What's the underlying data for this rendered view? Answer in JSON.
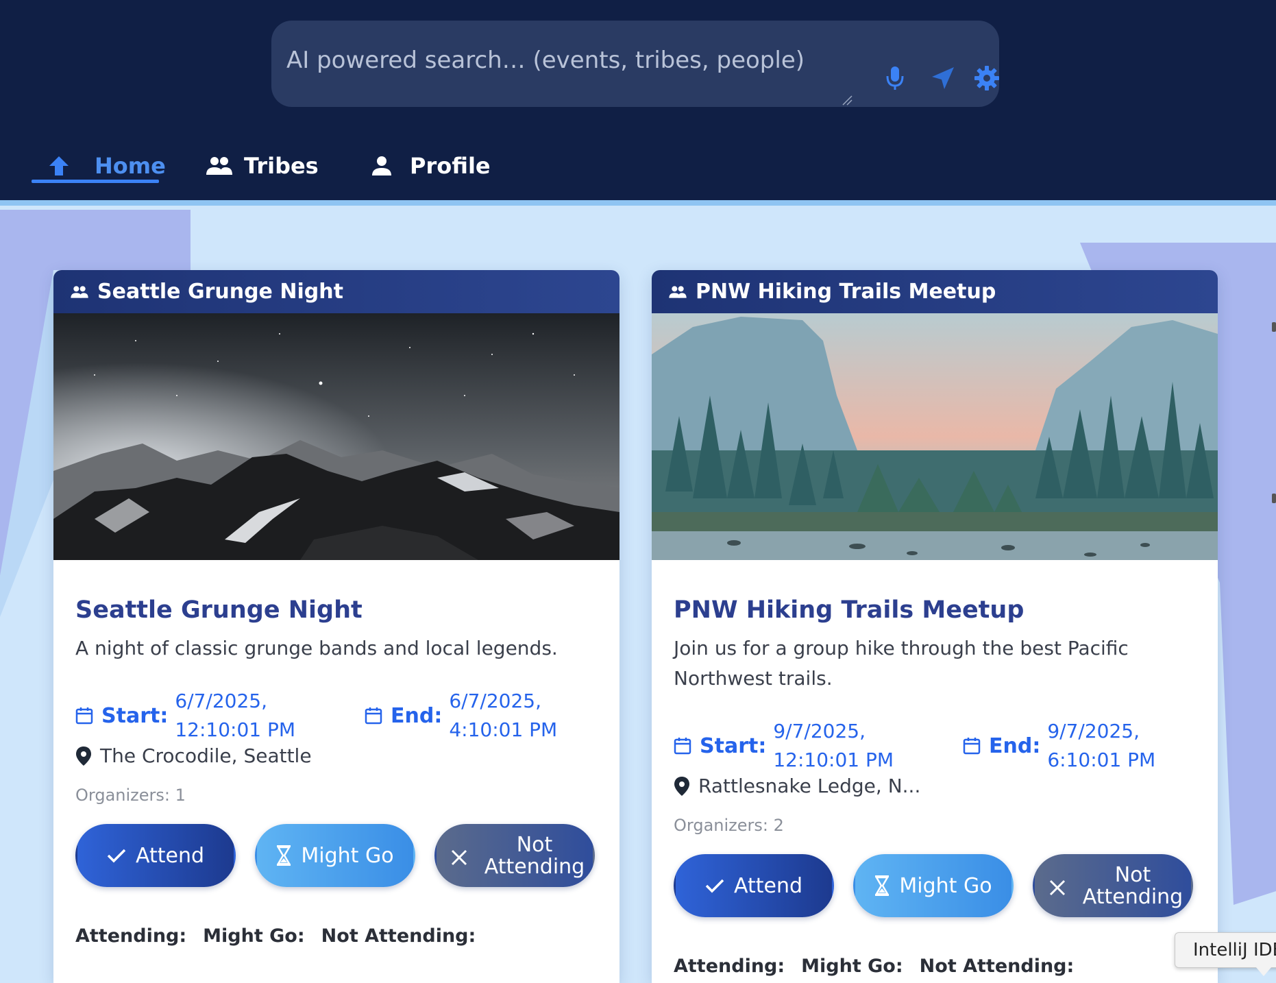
{
  "search": {
    "placeholder": "AI powered search… (events, tribes, people)",
    "icons": [
      "mic-icon",
      "send-icon",
      "gear-icon"
    ]
  },
  "nav": {
    "items": [
      {
        "label": "Home",
        "icon": "home-icon",
        "active": true
      },
      {
        "label": "Tribes",
        "icon": "people-icon",
        "active": false
      },
      {
        "label": "Profile",
        "icon": "person-icon",
        "active": false
      }
    ]
  },
  "colors": {
    "header_bg": "#101f45",
    "accent": "#3b82f6",
    "card_title": "#2c3f8f",
    "page_bg": "#cfe6fb"
  },
  "cards": [
    {
      "header": "Seattle Grunge Night",
      "title": "Seattle Grunge Night",
      "description": "A night of classic grunge bands and local legends.",
      "start_label": "Start:",
      "start_date": "6/7/2025,",
      "start_time": "12:10:01 PM",
      "end_label": "End:",
      "end_date": "6/7/2025,",
      "end_time": "4:10:01 PM",
      "location": "The Crocodile, Seattle",
      "organizers": "Organizers: 1",
      "attend": "Attend",
      "might_go": "Might Go",
      "not_attending": "Not Attending",
      "summary_attending": "Attending:",
      "summary_might": "Might Go:",
      "summary_not": "Not Attending:"
    },
    {
      "header": "PNW Hiking Trails Meetup",
      "title": "PNW Hiking Trails Meetup",
      "description": "Join us for a group hike through the best Pacific Northwest trails.",
      "start_label": "Start:",
      "start_date": "9/7/2025,",
      "start_time": "12:10:01 PM",
      "end_label": "End:",
      "end_date": "9/7/2025,",
      "end_time": "6:10:01 PM",
      "location": "Rattlesnake Ledge, N...",
      "organizers": "Organizers: 2",
      "attend": "Attend",
      "might_go": "Might Go",
      "not_attending": "Not Attending",
      "summary_attending": "Attending:",
      "summary_might": "Might Go:",
      "summary_not": "Not Attending:"
    }
  ],
  "tooltip": {
    "text": "IntelliJ IDEA"
  }
}
